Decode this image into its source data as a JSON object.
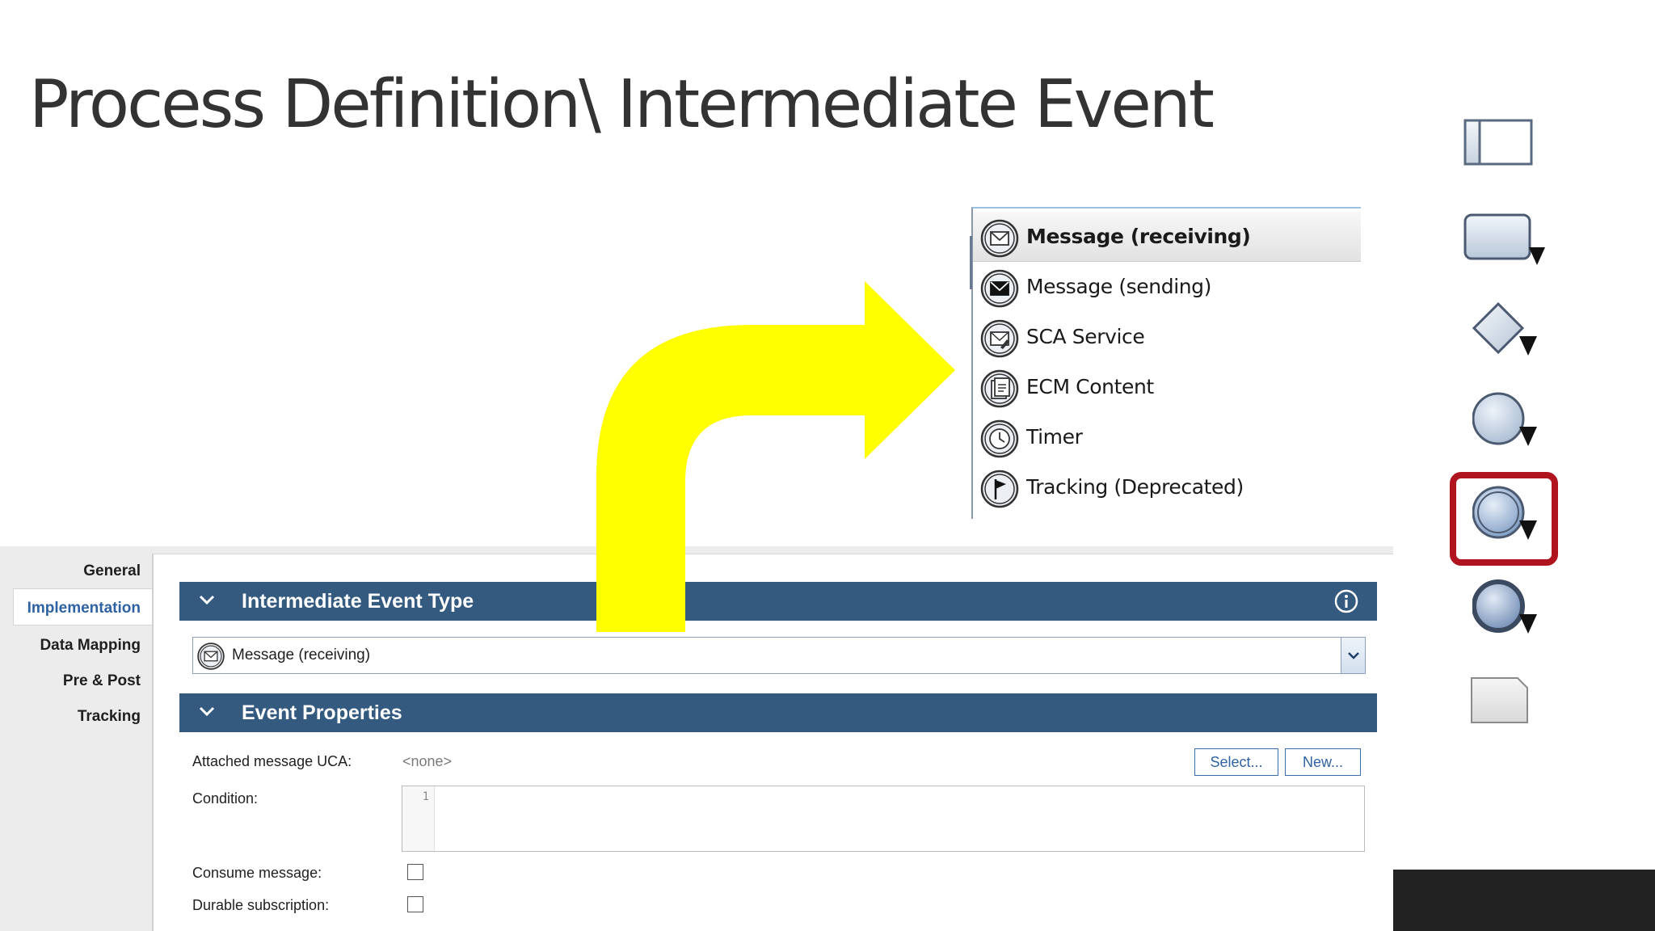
{
  "slide": {
    "title": "Process Definition\\ Intermediate Event"
  },
  "palette": {
    "items": [
      {
        "name": "lane",
        "icon": "lane-icon"
      },
      {
        "name": "activity",
        "icon": "activity-icon"
      },
      {
        "name": "gateway",
        "icon": "gateway-icon"
      },
      {
        "name": "start-event",
        "icon": "start-event-icon"
      },
      {
        "name": "intermediate-event",
        "icon": "intermediate-event-icon",
        "highlighted": true
      },
      {
        "name": "end-event",
        "icon": "end-event-icon"
      },
      {
        "name": "note",
        "icon": "note-icon"
      }
    ],
    "highlight_color": "#b0141e"
  },
  "event_menu": {
    "items": [
      {
        "label": "Message (receiving)",
        "icon": "envelope-open-icon",
        "selected": true
      },
      {
        "label": "Message (sending)",
        "icon": "envelope-filled-icon"
      },
      {
        "label": "SCA Service",
        "icon": "sca-service-icon"
      },
      {
        "label": "ECM Content",
        "icon": "document-icon"
      },
      {
        "label": "Timer",
        "icon": "clock-icon"
      },
      {
        "label": "Tracking (Deprecated)",
        "icon": "flag-icon"
      }
    ]
  },
  "tabs": {
    "items": [
      "General",
      "Implementation",
      "Data Mapping",
      "Pre & Post",
      "Tracking"
    ],
    "active": "Implementation"
  },
  "sections": {
    "event_type": {
      "title": "Intermediate Event Type",
      "selected_value": "Message (receiving)"
    },
    "event_properties": {
      "title": "Event Properties",
      "attached_uca_label": "Attached message UCA:",
      "attached_uca_value": "<none>",
      "select_button": "Select...",
      "new_button": "New...",
      "condition_label": "Condition:",
      "condition_line_number": "1",
      "consume_label": "Consume message:",
      "consume_checked": false,
      "durable_label": "Durable subscription:",
      "durable_checked": false
    }
  },
  "colors": {
    "section_bar": "#355a80",
    "active_tab_text": "#2f62a2",
    "arrow": "#ffff00"
  }
}
